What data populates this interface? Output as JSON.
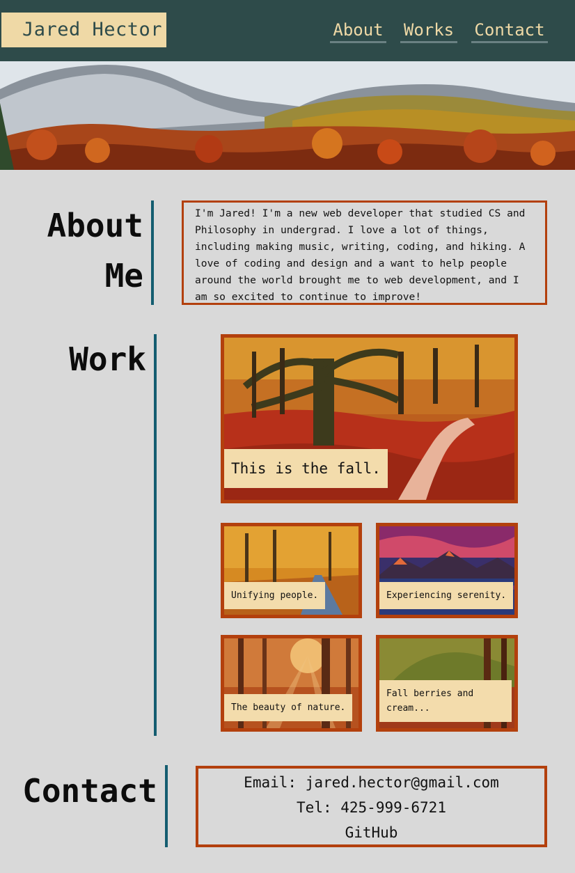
{
  "header": {
    "brand": "Jared Hector",
    "nav": [
      {
        "label": "About"
      },
      {
        "label": "Works"
      },
      {
        "label": "Contact"
      }
    ]
  },
  "about": {
    "title_line1": "About",
    "title_line2": "Me",
    "text": "I'm Jared! I'm a new web developer that studied CS and Philosophy in undergrad. I love a lot of things, including making music, writing, coding, and hiking. A love of coding and design and a want to help people around the world brought me to web development, and I am so excited to continue to improve!"
  },
  "work": {
    "title": "Work",
    "featured": {
      "caption": "This is the fall."
    },
    "items": [
      {
        "caption": "Unifying people."
      },
      {
        "caption": "Experiencing serenity."
      },
      {
        "caption": "The beauty of nature."
      },
      {
        "caption": "Fall berries and cream..."
      }
    ]
  },
  "contact": {
    "title": "Contact",
    "email": "Email: jared.hector@gmail.com",
    "phone": "Tel: 425-999-6721",
    "github": "GitHub"
  },
  "colors": {
    "header_bg": "#2e4b4a",
    "accent_cream": "#efd9a6",
    "border_orange": "#b3400d",
    "divider_teal": "#145d70",
    "page_bg": "#d9d9d9"
  },
  "icons": [
    "hero-landscape-image",
    "forest-photo"
  ]
}
